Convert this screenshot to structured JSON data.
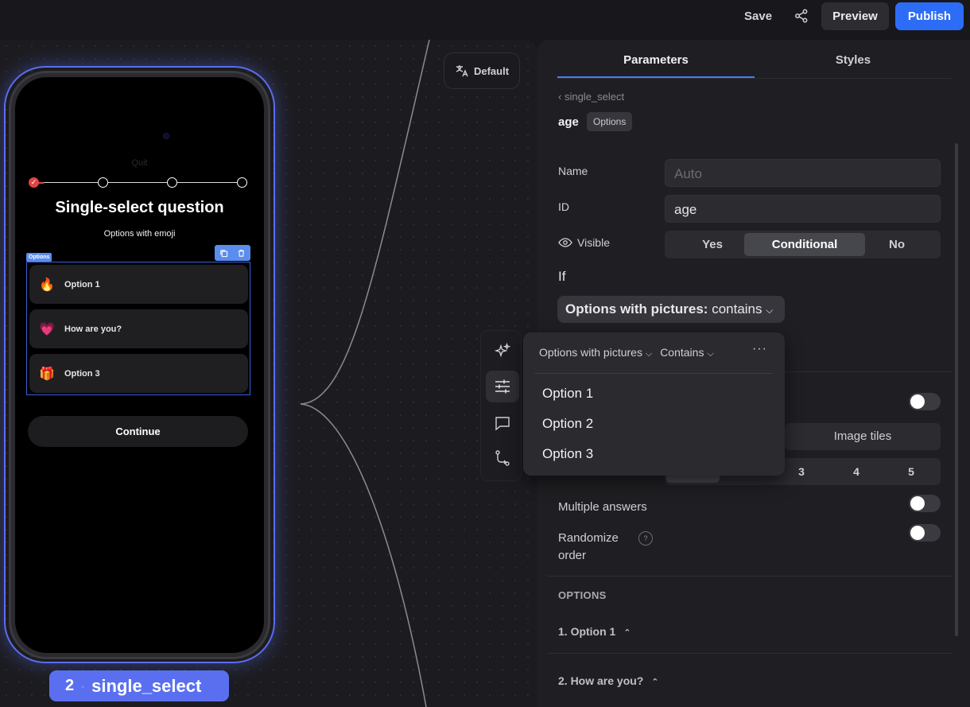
{
  "topbar": {
    "save": "Save",
    "preview": "Preview",
    "publish": "Publish"
  },
  "canvas": {
    "language_button": "Default",
    "node": {
      "number": "2",
      "separator": "·",
      "name": "single_select"
    }
  },
  "phone": {
    "quit": "Quit",
    "title": "Single-select question",
    "subtitle": "Options with emoji",
    "options_tag": "Options",
    "options": [
      {
        "emoji": "🔥",
        "label": "Option 1"
      },
      {
        "emoji": "💗",
        "label": "How are you?"
      },
      {
        "emoji": "🎁",
        "label": "Option 3"
      }
    ],
    "continue": "Continue",
    "progress": {
      "steps": 4,
      "completed": 1
    }
  },
  "panel": {
    "tabs": [
      "Parameters",
      "Styles"
    ],
    "breadcrumb": "single_select",
    "element_name": "age",
    "element_badge": "Options",
    "name_label": "Name",
    "name_placeholder": "Auto",
    "id_label": "ID",
    "id_value": "age",
    "visible_label": "Visible",
    "visible_options": [
      "Yes",
      "Conditional",
      "No"
    ],
    "visible_selected": "Conditional",
    "if_label": "If",
    "condition_field": "Options with pictures:",
    "condition_op": "contains",
    "display_right": "Image tiles",
    "columns": [
      "3",
      "4",
      "5"
    ],
    "multiple_answers": "Multiple answers",
    "randomize": "Randomize order",
    "options_section": "OPTIONS",
    "option_rows": [
      "1. Option 1",
      "2. How are you?"
    ]
  },
  "popup": {
    "field": "Options with pictures",
    "operator": "Contains",
    "more": "···",
    "items": [
      "Option 1",
      "Option 2",
      "Option 3"
    ]
  },
  "colors": {
    "accent": "#2d6cf6",
    "node": "#5a6ff0",
    "progress_done": "#e04545"
  }
}
